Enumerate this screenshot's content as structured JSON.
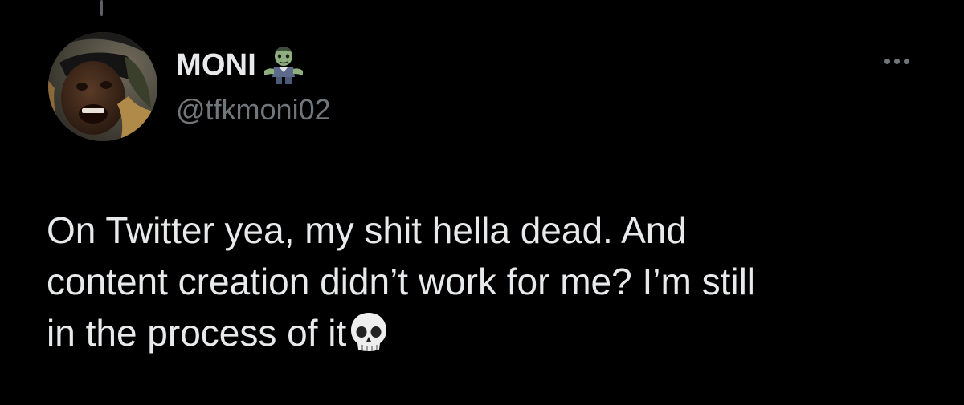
{
  "tweet": {
    "author": {
      "display_name": "MONI",
      "name_emoji": "zombie-emoji",
      "handle": "@tfkmoni02"
    },
    "text_lines": [
      "On Twitter yea, my shit hella dead. And",
      "content creation didn’t work for me? I’m still",
      "in the process of it"
    ],
    "text_end_emoji": "skull-emoji",
    "more_icon": "more-horizontal-icon"
  },
  "colors": {
    "background": "#000000",
    "primary_text": "#e7e9ea",
    "secondary_text": "#71767b",
    "thread_line": "#5b6066"
  }
}
